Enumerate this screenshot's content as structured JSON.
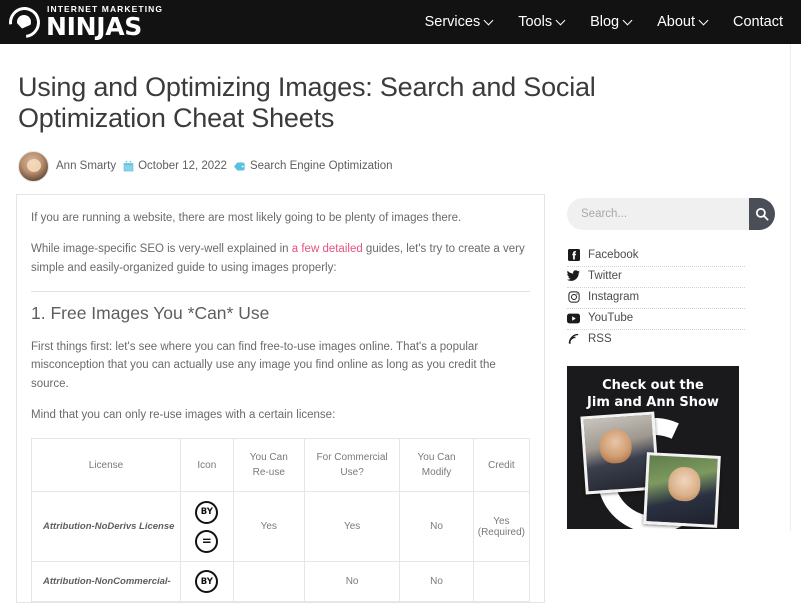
{
  "header": {
    "logo": {
      "sub": "INTERNET MARKETING",
      "main": "NINJAS",
      "mark_icon": "ninja-swirl-icon"
    },
    "nav": [
      {
        "label": "Services",
        "has_caret": true
      },
      {
        "label": "Tools",
        "has_caret": true
      },
      {
        "label": "Blog",
        "has_caret": true
      },
      {
        "label": "About",
        "has_caret": true
      },
      {
        "label": "Contact",
        "has_caret": false
      }
    ]
  },
  "post": {
    "title": "Using and Optimizing Images: Search and Social Optimization Cheat Sheets",
    "author": "Ann Smarty",
    "date": "October 12, 2022",
    "category": "Search Engine Optimization",
    "calendar_icon": "calendar-icon",
    "tag_icon": "tag-icon"
  },
  "article": {
    "p1": "If you are running a website, there are most likely going to be plenty of images there.",
    "p2_before": "While image-specific SEO is very-well explained in ",
    "p2_link": "a few detailed",
    "p2_after": " guides, let's try to create a very simple and easily-organized guide to using images properly:",
    "h2": "1. Free Images You *Can* Use",
    "p3": "First things first: let's see where you can find free-to-use images online. That's a popular misconception that you can actually use any image you find online as long as you credit the source.",
    "p4": "Mind that you can only re-use images with a certain license:"
  },
  "table": {
    "headers": [
      "License",
      "Icon",
      "You Can Re-use",
      "For Commercial Use?",
      "You Can Modify",
      "Credit"
    ],
    "header_lines": [
      [
        "License"
      ],
      [
        "Icon"
      ],
      [
        "You Can",
        "Re-use"
      ],
      [
        "For Commercial",
        "Use?"
      ],
      [
        "You Can",
        "Modify"
      ],
      [
        "Credit"
      ]
    ],
    "rows": [
      {
        "license": "Attribution-NoDerivs License",
        "badges": [
          "BY",
          "="
        ],
        "reuse": "Yes",
        "commercial": "Yes",
        "modify": "No",
        "credit": "Yes (Required)",
        "credit_lines": [
          "Yes",
          "(Required)"
        ]
      },
      {
        "license": "Attribution-NonCommercial-",
        "badges": [
          "BY"
        ],
        "reuse": "",
        "commercial": "No",
        "modify": "No",
        "credit": ""
      }
    ]
  },
  "sidebar": {
    "search": {
      "placeholder": "Search...",
      "value": "",
      "button_icon": "search-icon"
    },
    "social": [
      {
        "label": "Facebook",
        "icon": "facebook-icon",
        "glyph": "f"
      },
      {
        "label": "Twitter",
        "icon": "twitter-icon",
        "glyph": "t"
      },
      {
        "label": "Instagram",
        "icon": "instagram-icon",
        "glyph": "i"
      },
      {
        "label": "YouTube",
        "icon": "youtube-icon",
        "glyph": "y"
      },
      {
        "label": "RSS",
        "icon": "rss-icon",
        "glyph": "r"
      }
    ],
    "promo": {
      "line1": "Check out the",
      "line2": "Jim and Ann Show"
    }
  },
  "colors": {
    "header_bg": "#121212",
    "link_pink": "#e4537d",
    "meta_blue": "#5bc0de",
    "search_btn": "#4a4f57",
    "text_gray": "#6a6a6a"
  }
}
